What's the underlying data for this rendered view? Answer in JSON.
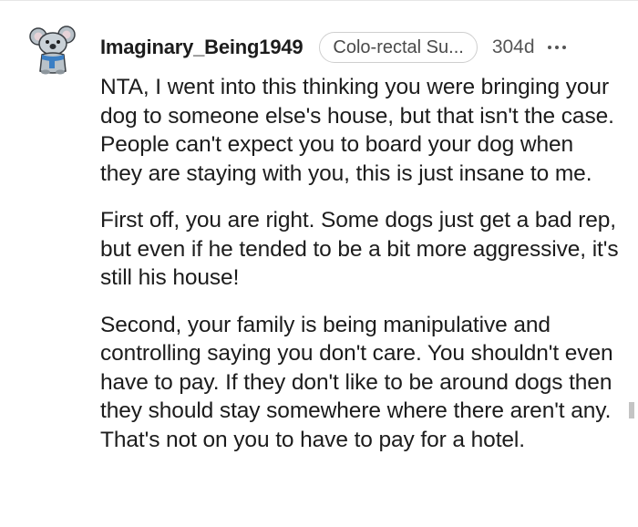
{
  "comment": {
    "username": "Imaginary_Being1949",
    "flair": "Colo-rectal Su...",
    "age": "304d",
    "paragraphs": [
      "NTA, I went into this thinking you were bringing your dog to someone else's house, but that isn't the case. People can't expect you to board your dog when they are staying with you, this is just insane to me.",
      "First off, you are right. Some dogs just get a bad rep, but even if he tended to be a bit more aggressive, it's still his house!",
      "Second, your family is being manipulative and controlling saying you don't care. You shouldn't even have to pay. If they don't like to be around dogs then they should stay somewhere where there aren't any. That's not on you to have to pay for a hotel."
    ]
  },
  "icons": {
    "avatar": "koala-snoo-avatar",
    "more": "more-options-icon"
  },
  "colors": {
    "text": "#1c1c1c",
    "meta": "#555555",
    "flair_border": "#cfcfcf"
  }
}
